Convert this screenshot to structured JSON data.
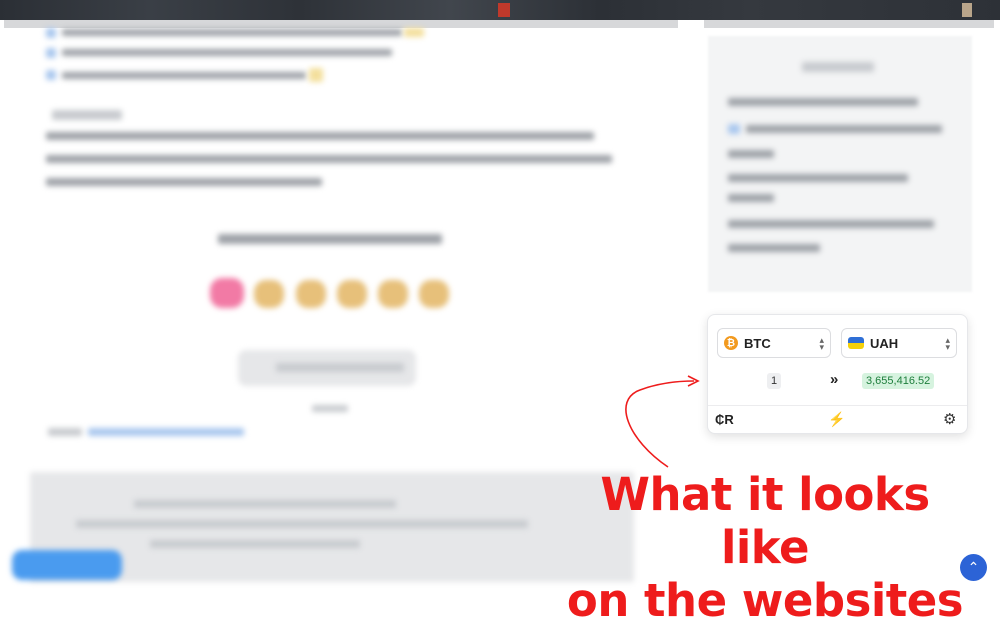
{
  "converter": {
    "from_currency": "BTC",
    "from_icon": "bitcoin-icon",
    "to_currency": "UAH",
    "to_icon": "ukraine-flag-icon",
    "amount": "1",
    "arrows": "»",
    "result": "3,655,416.52",
    "footer_left": "₵R",
    "footer_middle_icon": "lightning-icon",
    "footer_right_icon": "gear-icon",
    "accent_color": "#f29a1f",
    "result_color": "#1e7e3c"
  },
  "annotation": {
    "line1": "What it looks like",
    "line2": "on the websites",
    "color": "#ee1c1c"
  },
  "scroll_top": {
    "icon": "chevron-up-icon"
  }
}
